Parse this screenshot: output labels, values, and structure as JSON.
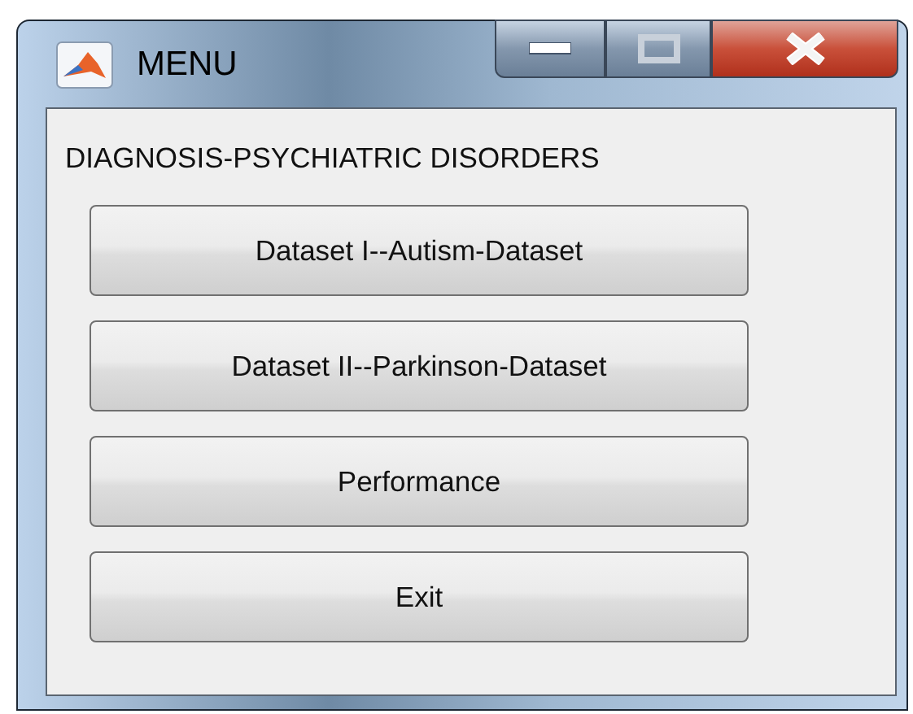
{
  "window": {
    "title": "MENU"
  },
  "heading": "DIAGNOSIS-PSYCHIATRIC DISORDERS",
  "buttons": [
    "Dataset I--Autism-Dataset",
    "Dataset II--Parkinson-Dataset",
    "Performance",
    "Exit"
  ]
}
